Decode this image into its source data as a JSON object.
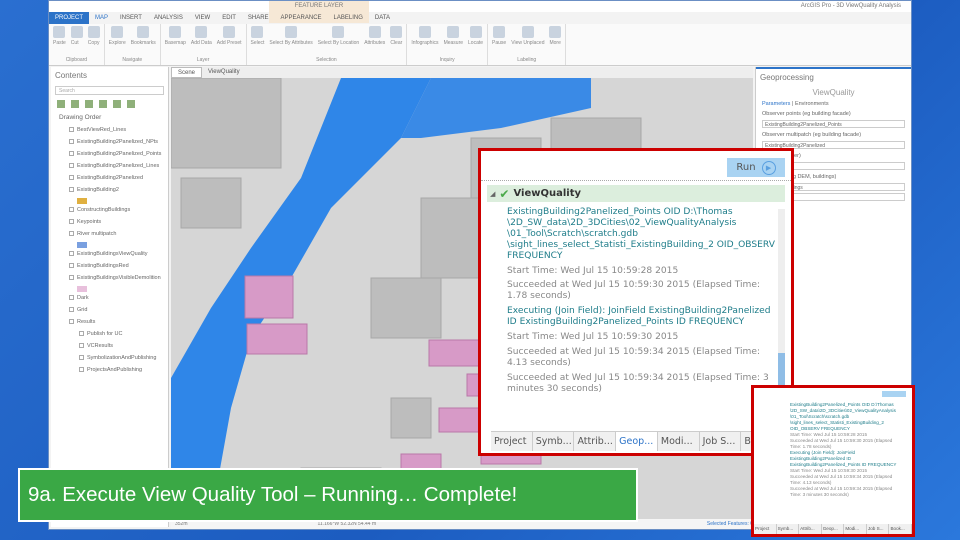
{
  "app": {
    "title": "ArcGIS Pro - 3D ViewQuality Analysis",
    "context_tab": "FEATURE LAYER"
  },
  "ribbon_tabs": [
    "PROJECT",
    "MAP",
    "INSERT",
    "ANALYSIS",
    "VIEW",
    "EDIT",
    "SHARE",
    "APPEARANCE",
    "LABELING",
    "DATA"
  ],
  "ribbon_groups": [
    {
      "label": "Clipboard",
      "items": [
        "Paste",
        "Cut",
        "Copy"
      ]
    },
    {
      "label": "Navigate",
      "items": [
        "Explore",
        "Bookmarks"
      ]
    },
    {
      "label": "Layer",
      "items": [
        "Basemap",
        "Add Data",
        "Add Preset"
      ]
    },
    {
      "label": "Selection",
      "items": [
        "Select",
        "Select By Attributes",
        "Select By Location",
        "Attributes",
        "Clear"
      ]
    },
    {
      "label": "Inquiry",
      "items": [
        "Infographics",
        "Measure",
        "Locate"
      ]
    },
    {
      "label": "Labeling",
      "items": [
        "Pause",
        "View Unplaced",
        "More"
      ]
    }
  ],
  "contents": {
    "title": "Contents",
    "search_placeholder": "Search",
    "section": "Drawing Order",
    "layers": [
      "BestViewRed_Lines",
      "ExistingBuilding2Panelized_NPts",
      "ExistingBuilding2Panelized_Points",
      "ExistingBuilding2Panelized_Lines",
      "ExistingBuilding2Panelized",
      "ExistingBuilding2",
      "ConstructingBuildings",
      "Keypoints",
      "River multipatch",
      "ExistingBuildingsViewQuality",
      "ExistingBuildingsRed",
      "ExistingBuildingsVisibleDemolition",
      "Dark",
      "Grid",
      "Results",
      "Publish for UC",
      "VCResults",
      "SymbolizationAndPublishing",
      "ProjectsAndPublishing"
    ]
  },
  "map": {
    "tabs": [
      "Scene",
      "ViewQuality"
    ],
    "scale": "352m",
    "coords": "11.166°W 52.32N 54.44 m",
    "selected": "Selected Features: 0"
  },
  "geoprocessing": {
    "title": "Geoprocessing",
    "tool": "ViewQuality",
    "tabs": [
      "Parameters",
      "Environments"
    ],
    "params": [
      {
        "label": "Observer points (eg building facade)",
        "value": "ExistingBuilding2Panelized_Points"
      },
      {
        "label": "Observer multipatch (eg building facade)",
        "value": "ExistingBuilding2Panelized"
      },
      {
        "label": "Target (eg river)",
        "value": "River"
      },
      {
        "label": "Obstacles (eg DEM, buildings)",
        "value": "ExistingBuildings"
      },
      {
        "label": "",
        "value": "Dark_"
      }
    ]
  },
  "callout": {
    "run_label": "Run",
    "tool_name": "ViewQuality",
    "messages": [
      {
        "t": "ExistingBuilding2Panelized_Points OID D:\\Thomas \\2D_SW_data\\2D_3DCities\\02_ViewQualityAnalysis \\01_Tool\\Scratch\\scratch.gdb \\sight_lines_select_Statisti_ExistingBuilding_2 OID_OBSERV FREQUENCY",
        "k": "c"
      },
      {
        "t": "Start Time: Wed Jul 15 10:59:28 2015",
        "k": "g"
      },
      {
        "t": "Succeeded at Wed Jul 15 10:59:30 2015 (Elapsed Time: 1.78 seconds)",
        "k": "g"
      },
      {
        "t": "Executing (Join Field): JoinField ExistingBuilding2Panelized ID ExistingBuilding2Panelized_Points ID FREQUENCY",
        "k": "c"
      },
      {
        "t": "Start Time: Wed Jul 15 10:59:30 2015",
        "k": "g"
      },
      {
        "t": "Succeeded at Wed Jul 15 10:59:34 2015 (Elapsed Time: 4.13 seconds)",
        "k": "g"
      },
      {
        "t": "Succeeded at Wed Jul 15 10:59:34 2015 (Elapsed Time: 3 minutes 30 seconds)",
        "k": "g"
      }
    ],
    "bottom_tabs": [
      "Project",
      "Symb...",
      "Attrib...",
      "Geop...",
      "Modi...",
      "Job S...",
      "Book..."
    ]
  },
  "caption": "9a. Execute View Quality Tool – Running… Complete!"
}
